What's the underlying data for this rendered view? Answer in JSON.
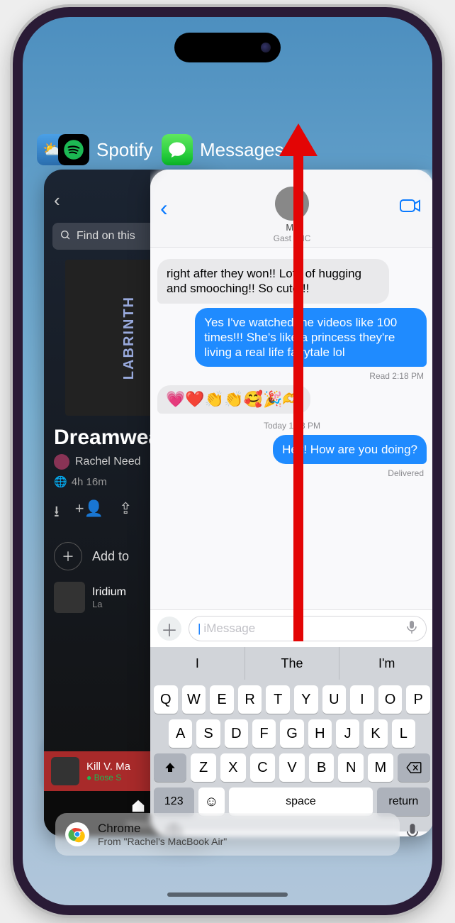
{
  "switcher": {
    "spotify_label": "Spotify",
    "messages_label": "Messages",
    "spotify_icon": "spotify-icon",
    "messages_icon": "messages-icon",
    "weather_icon": "weather-icon"
  },
  "spotify": {
    "search_placeholder": "Find on this",
    "playlist_title": "Dreamwea",
    "by_label": "Rachel Need",
    "duration": "4h 16m",
    "addto_label": "Add to",
    "album_sideways": "LABRINTH",
    "tracks": [
      {
        "name": "Iridium",
        "artist": "La"
      },
      {
        "name": "Kill V. Ma",
        "artist": "Bose S"
      }
    ],
    "tab_home": "Home"
  },
  "messages": {
    "contact_name": "M",
    "contact_location": "Gast   , NC",
    "bubble_incoming_1": "right after they won!! Lots of hugging and smooching!! So cute!!!",
    "bubble_outgoing_1": "Yes I've watched the videos like 100 times!!! She's like a princess they're living a real life fairytale lol",
    "status_read": "Read 2:18 PM",
    "emoji_row": "💗❤️👏👏🥰🎉🫶",
    "day_stamp": "Today 1:43 PM",
    "bubble_outgoing_2": "Hey! How are you doing?",
    "status_delivered": "Delivered",
    "compose_placeholder": "iMessage",
    "predictions": [
      "I",
      "The",
      "I'm"
    ],
    "keyboard": {
      "row1": [
        "Q",
        "W",
        "E",
        "R",
        "T",
        "Y",
        "U",
        "I",
        "O",
        "P"
      ],
      "row2": [
        "A",
        "S",
        "D",
        "F",
        "G",
        "H",
        "J",
        "K",
        "L"
      ],
      "row3": [
        "Z",
        "X",
        "C",
        "V",
        "B",
        "N",
        "M"
      ],
      "numbers_key": "123",
      "space_key": "space",
      "return_key": "return"
    }
  },
  "handoff": {
    "app": "Chrome",
    "from": "From \"Rachel's MacBook Air\""
  },
  "arrow": {
    "color": "#e30505"
  }
}
